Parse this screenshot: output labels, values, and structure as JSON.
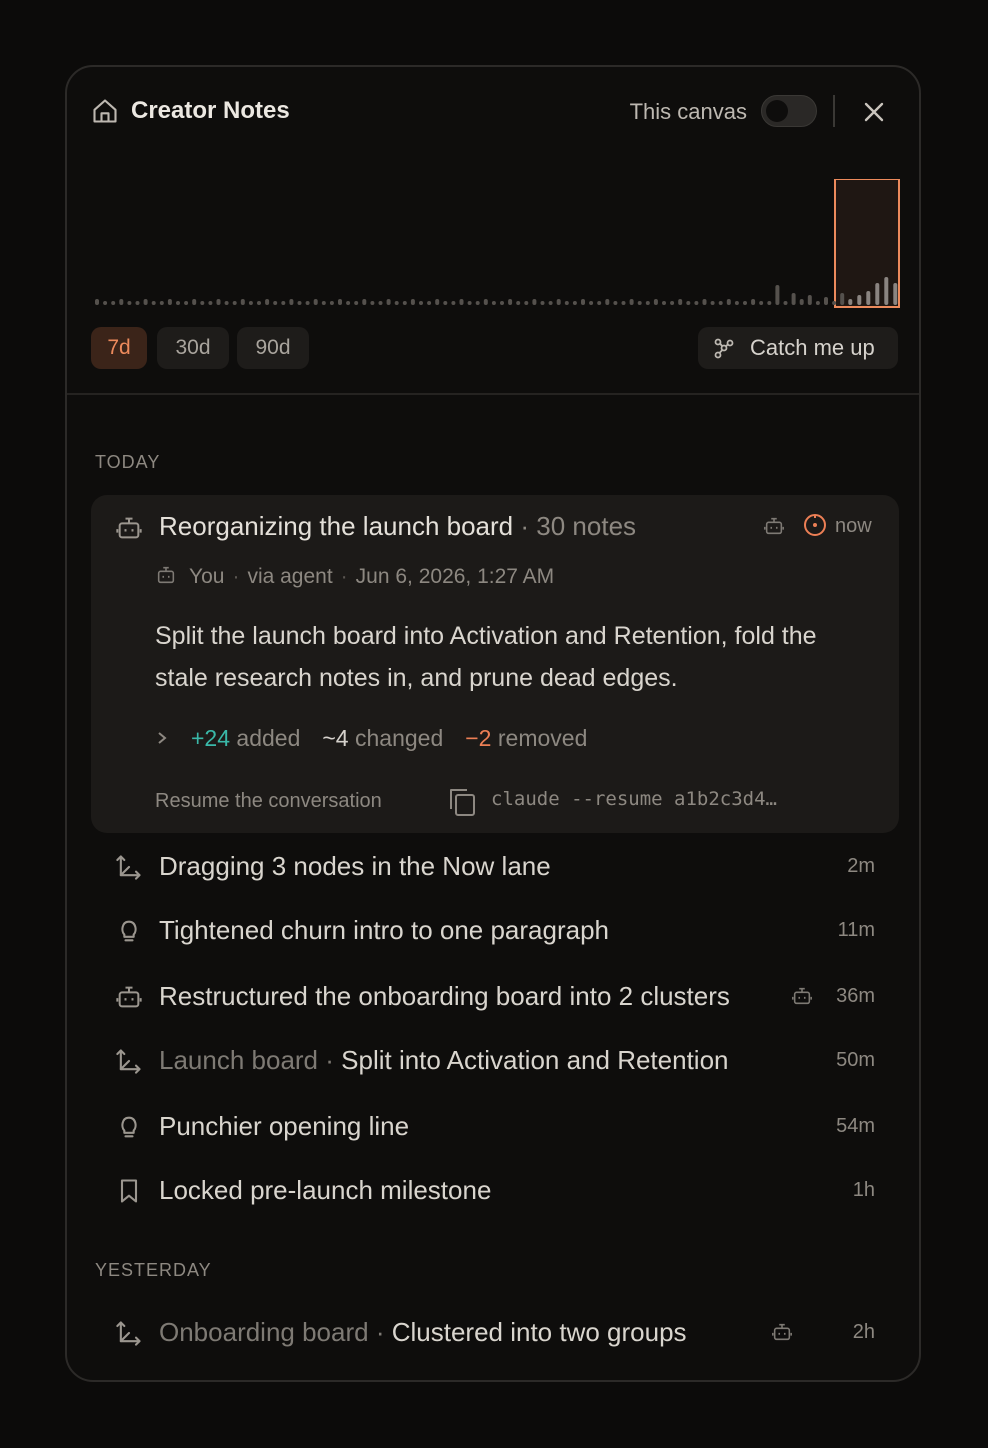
{
  "header": {
    "title": "Creator Notes",
    "canvas_toggle_label": "This canvas",
    "canvas_toggle_on": false
  },
  "activity_chart": {
    "type": "bar",
    "selected_range": "7d",
    "accent": "#ec8a5c"
  },
  "ranges": [
    {
      "label": "7d",
      "active": true
    },
    {
      "label": "30d",
      "active": false
    },
    {
      "label": "90d",
      "active": false
    }
  ],
  "catch_up_label": "Catch me up",
  "sections": {
    "today": "TODAY",
    "yesterday": "YESTERDAY"
  },
  "featured": {
    "title": "Reorganizing the launch board",
    "sep": "·",
    "notes_count": "30 notes",
    "time": "now",
    "author": "You",
    "via": "via agent",
    "date": "Jun 6, 2026, 1:27 AM",
    "summary": "Split the launch board into Activation and Retention, fold the stale research notes in, and prune dead edges.",
    "added": "+24",
    "added_label": "added",
    "changed": "~4",
    "changed_label": "changed",
    "removed": "−2",
    "removed_label": "removed",
    "resume_label": "Resume the conversation",
    "command": "claude --resume a1b2c3d4…"
  },
  "items": [
    {
      "icon": "move-icon",
      "prefix": "",
      "text": "Dragging 3 nodes in the Now lane",
      "time": "2m",
      "agent": false
    },
    {
      "icon": "lightbulb-icon",
      "prefix": "",
      "text": "Tightened churn intro to one paragraph",
      "time": "11m",
      "agent": false
    },
    {
      "icon": "robot-icon",
      "prefix": "",
      "text": "Restructured the onboarding board into 2 clusters",
      "time": "36m",
      "agent": true
    },
    {
      "icon": "move-icon",
      "prefix": "Launch board · ",
      "text": "Split into Activation and Retention",
      "time": "50m",
      "agent": false
    },
    {
      "icon": "lightbulb-icon",
      "prefix": "",
      "text": "Punchier opening line",
      "time": "54m",
      "agent": false
    },
    {
      "icon": "bookmark-icon",
      "prefix": "",
      "text": "Locked pre-launch milestone",
      "time": "1h",
      "agent": false
    }
  ],
  "yesterday_items": [
    {
      "icon": "move-icon",
      "prefix": "Onboarding board · ",
      "text": "Clustered into two groups",
      "time": "2h",
      "agent": true
    }
  ]
}
